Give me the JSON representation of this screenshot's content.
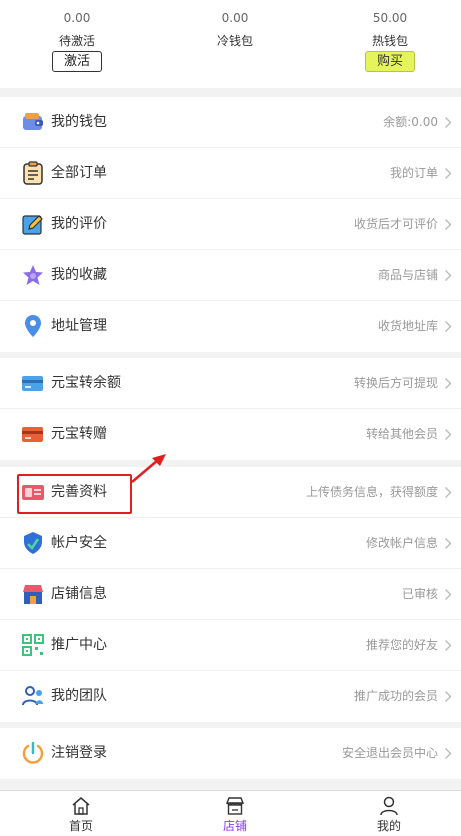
{
  "wallet": {
    "pending": {
      "amount": "0.00",
      "label": "待激活",
      "button": "激活"
    },
    "cold": {
      "amount": "0.00",
      "label": "冷钱包"
    },
    "hot": {
      "amount": "50.00",
      "label": "热钱包",
      "button": "购买"
    }
  },
  "menu": {
    "group1": [
      {
        "title": "我的钱包",
        "hint": "余额:0.00",
        "icon": "wallet-icon"
      },
      {
        "title": "全部订单",
        "hint": "我的订单",
        "icon": "clipboard-icon"
      },
      {
        "title": "我的评价",
        "hint": "收货后才可评价",
        "icon": "edit-icon"
      },
      {
        "title": "我的收藏",
        "hint": "商品与店铺",
        "icon": "star-icon"
      },
      {
        "title": "地址管理",
        "hint": "收货地址库",
        "icon": "location-pin-icon"
      }
    ],
    "group2": [
      {
        "title": "元宝转余额",
        "hint": "转换后方可提现",
        "icon": "card-icon"
      },
      {
        "title": "元宝转赠",
        "hint": "转给其他会员",
        "icon": "card-gift-icon"
      }
    ],
    "group3": [
      {
        "title": "完善资料",
        "hint": "上传债务信息，获得额度",
        "icon": "id-card-icon"
      },
      {
        "title": "帐户安全",
        "hint": "修改帐户信息",
        "icon": "shield-icon"
      },
      {
        "title": "店铺信息",
        "hint": "已审核",
        "icon": "store-icon"
      },
      {
        "title": "推广中心",
        "hint": "推荐您的好友",
        "icon": "qr-code-icon"
      },
      {
        "title": "我的团队",
        "hint": "推广成功的会员",
        "icon": "team-icon"
      }
    ],
    "group4": [
      {
        "title": "注销登录",
        "hint": "安全退出会员中心",
        "icon": "power-icon"
      }
    ]
  },
  "tabbar": {
    "home": {
      "label": "首页",
      "icon": "home-icon"
    },
    "store": {
      "label": "店铺",
      "icon": "store-icon",
      "active": true
    },
    "mine": {
      "label": "我的",
      "icon": "user-icon"
    }
  },
  "colors": {
    "accent": "#8a3df0",
    "highlight": "#e02020",
    "buy_button": "#e6f45c"
  }
}
